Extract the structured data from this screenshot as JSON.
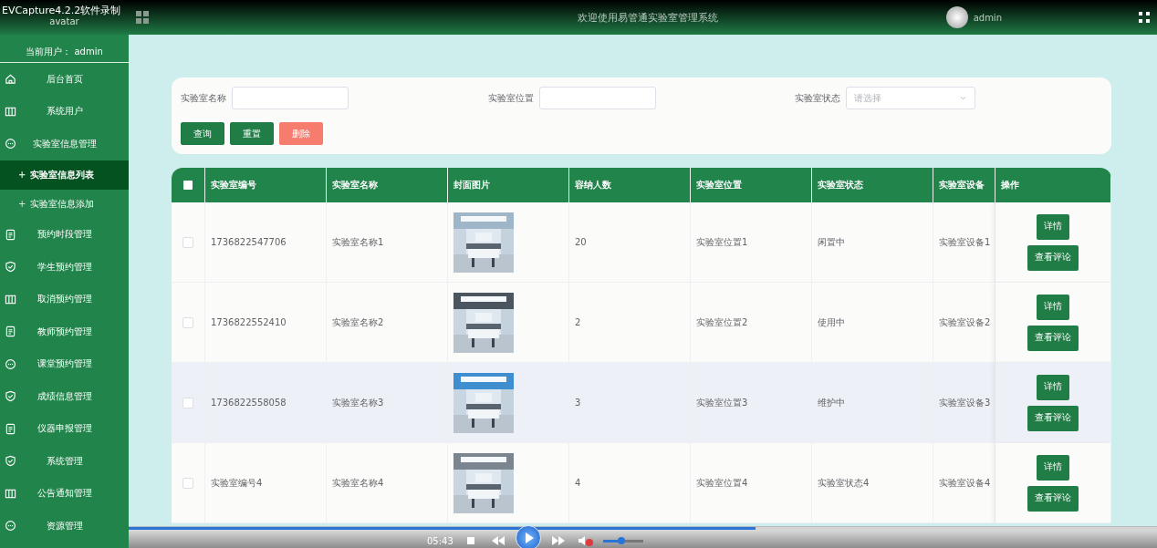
{
  "recorder_label": "EVCapture4.2.2软件录制",
  "sidebar": {
    "avatar_alt": "avatar",
    "current_user": "当前用户： admin",
    "items": [
      {
        "label": "后台首页",
        "kind": "home",
        "selected": false
      },
      {
        "label": "系统用户",
        "kind": "columns",
        "selected": false
      },
      {
        "label": "实验室信息管理",
        "kind": "chat",
        "selected": false,
        "expanded": true,
        "children": [
          {
            "bullet": "+",
            "label": "实验室信息列表",
            "selected": true
          },
          {
            "bullet": "+",
            "label": "实验室信息添加",
            "selected": false
          }
        ]
      },
      {
        "label": "预约时段管理",
        "kind": "doc",
        "selected": false
      },
      {
        "label": "学生预约管理",
        "kind": "shield",
        "selected": false
      },
      {
        "label": "取消预约管理",
        "kind": "columns",
        "selected": false
      },
      {
        "label": "教师预约管理",
        "kind": "doc",
        "selected": false
      },
      {
        "label": "课堂预约管理",
        "kind": "chat",
        "selected": false
      },
      {
        "label": "成绩信息管理",
        "kind": "shield",
        "selected": false
      },
      {
        "label": "仪器申报管理",
        "kind": "doc",
        "selected": false
      },
      {
        "label": "系统管理",
        "kind": "shield",
        "selected": false
      },
      {
        "label": "公告通知管理",
        "kind": "columns",
        "selected": false
      },
      {
        "label": "资源管理",
        "kind": "chat",
        "selected": false
      }
    ]
  },
  "header": {
    "title": "欢迎使用易管通实验室管理系统",
    "user": "admin"
  },
  "search": {
    "fields": [
      {
        "label": "实验室名称",
        "kind": "text"
      },
      {
        "label": "实验室位置",
        "kind": "text"
      },
      {
        "label": "实验室状态",
        "kind": "select",
        "placeholder": "请选择"
      }
    ],
    "buttons": [
      {
        "label": "查询",
        "kind": "primary"
      },
      {
        "label": "重置",
        "kind": "primary"
      },
      {
        "label": "删除",
        "kind": "danger"
      }
    ]
  },
  "table": {
    "select_all": {
      "checked": false
    },
    "columns": [
      "实验室编号",
      "实验室名称",
      "封面图片",
      "容纳人数",
      "实验室位置",
      "实验室状态",
      "实验室设备",
      "操作"
    ],
    "rows": [
      {
        "checked": false,
        "hovered": false,
        "cells": [
          "1736822547706",
          "实验室名称1",
          "",
          "20",
          "实验室位置1",
          "闲置中",
          "实验室设备1"
        ],
        "image": {
          "kind": "picture"
        },
        "actions": [
          "详情",
          "查看评论"
        ]
      },
      {
        "checked": false,
        "hovered": false,
        "cells": [
          "1736822552410",
          "实验室名称2",
          "",
          "2",
          "实验室位置2",
          "使用中",
          "实验室设备2"
        ],
        "image": {
          "kind": "picture"
        },
        "actions": [
          "详情",
          "查看评论"
        ]
      },
      {
        "checked": false,
        "hovered": true,
        "cells": [
          "1736822558058",
          "实验室名称3",
          "",
          "3",
          "实验室位置3",
          "维护中",
          "实验室设备3"
        ],
        "image": {
          "kind": "picture"
        },
        "actions": [
          "详情",
          "查看评论"
        ]
      },
      {
        "checked": false,
        "hovered": false,
        "cells": [
          "实验室编号4",
          "实验室名称4",
          "",
          "4",
          "实验室位置4",
          "实验室状态4",
          "实验室设备4"
        ],
        "image": {
          "kind": "picture"
        },
        "actions": [
          "详情",
          "查看评论"
        ]
      }
    ]
  },
  "player": {
    "time": "05:43",
    "progress": {
      "level": 0.61
    },
    "volume": {
      "level": 0.45
    },
    "muted": true
  }
}
